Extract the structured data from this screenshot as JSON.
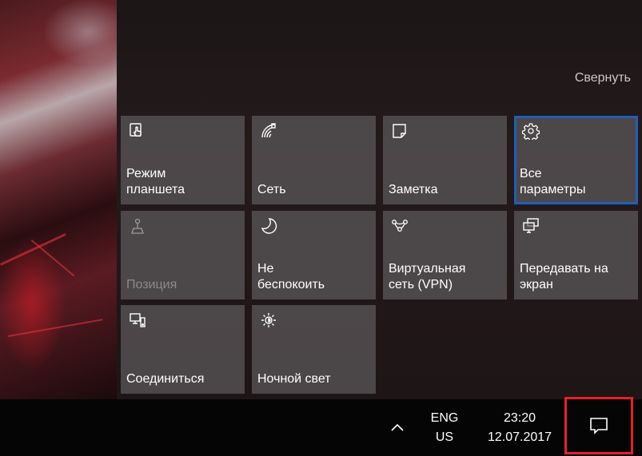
{
  "action_center": {
    "collapse_label": "Свернуть",
    "tiles": [
      {
        "label": "Режим\nпланшета",
        "icon": "tablet-mode-icon",
        "state": "normal"
      },
      {
        "label": "Сеть",
        "icon": "network-icon",
        "state": "normal"
      },
      {
        "label": "Заметка",
        "icon": "note-icon",
        "state": "normal"
      },
      {
        "label": "Все\nпараметры",
        "icon": "gear-icon",
        "state": "selected"
      },
      {
        "label": "Позиция",
        "icon": "location-icon",
        "state": "disabled"
      },
      {
        "label": "Не\nбеспокоить",
        "icon": "moon-icon",
        "state": "normal"
      },
      {
        "label": "Виртуальная\nсеть (VPN)",
        "icon": "vpn-icon",
        "state": "normal"
      },
      {
        "label": "Передавать на\nэкран",
        "icon": "project-icon",
        "state": "normal"
      },
      {
        "label": "Соединиться",
        "icon": "connect-icon",
        "state": "normal"
      },
      {
        "label": "Ночной свет",
        "icon": "night-light-icon",
        "state": "normal"
      }
    ]
  },
  "taskbar": {
    "language_line1": "ENG",
    "language_line2": "US",
    "time": "23:20",
    "date": "12.07.2017",
    "notifications_icon": "action-center-icon"
  },
  "colors": {
    "tile_bg": "#58545699",
    "selected_outline": "#1f5fb8",
    "highlight_box": "#e8202a"
  }
}
